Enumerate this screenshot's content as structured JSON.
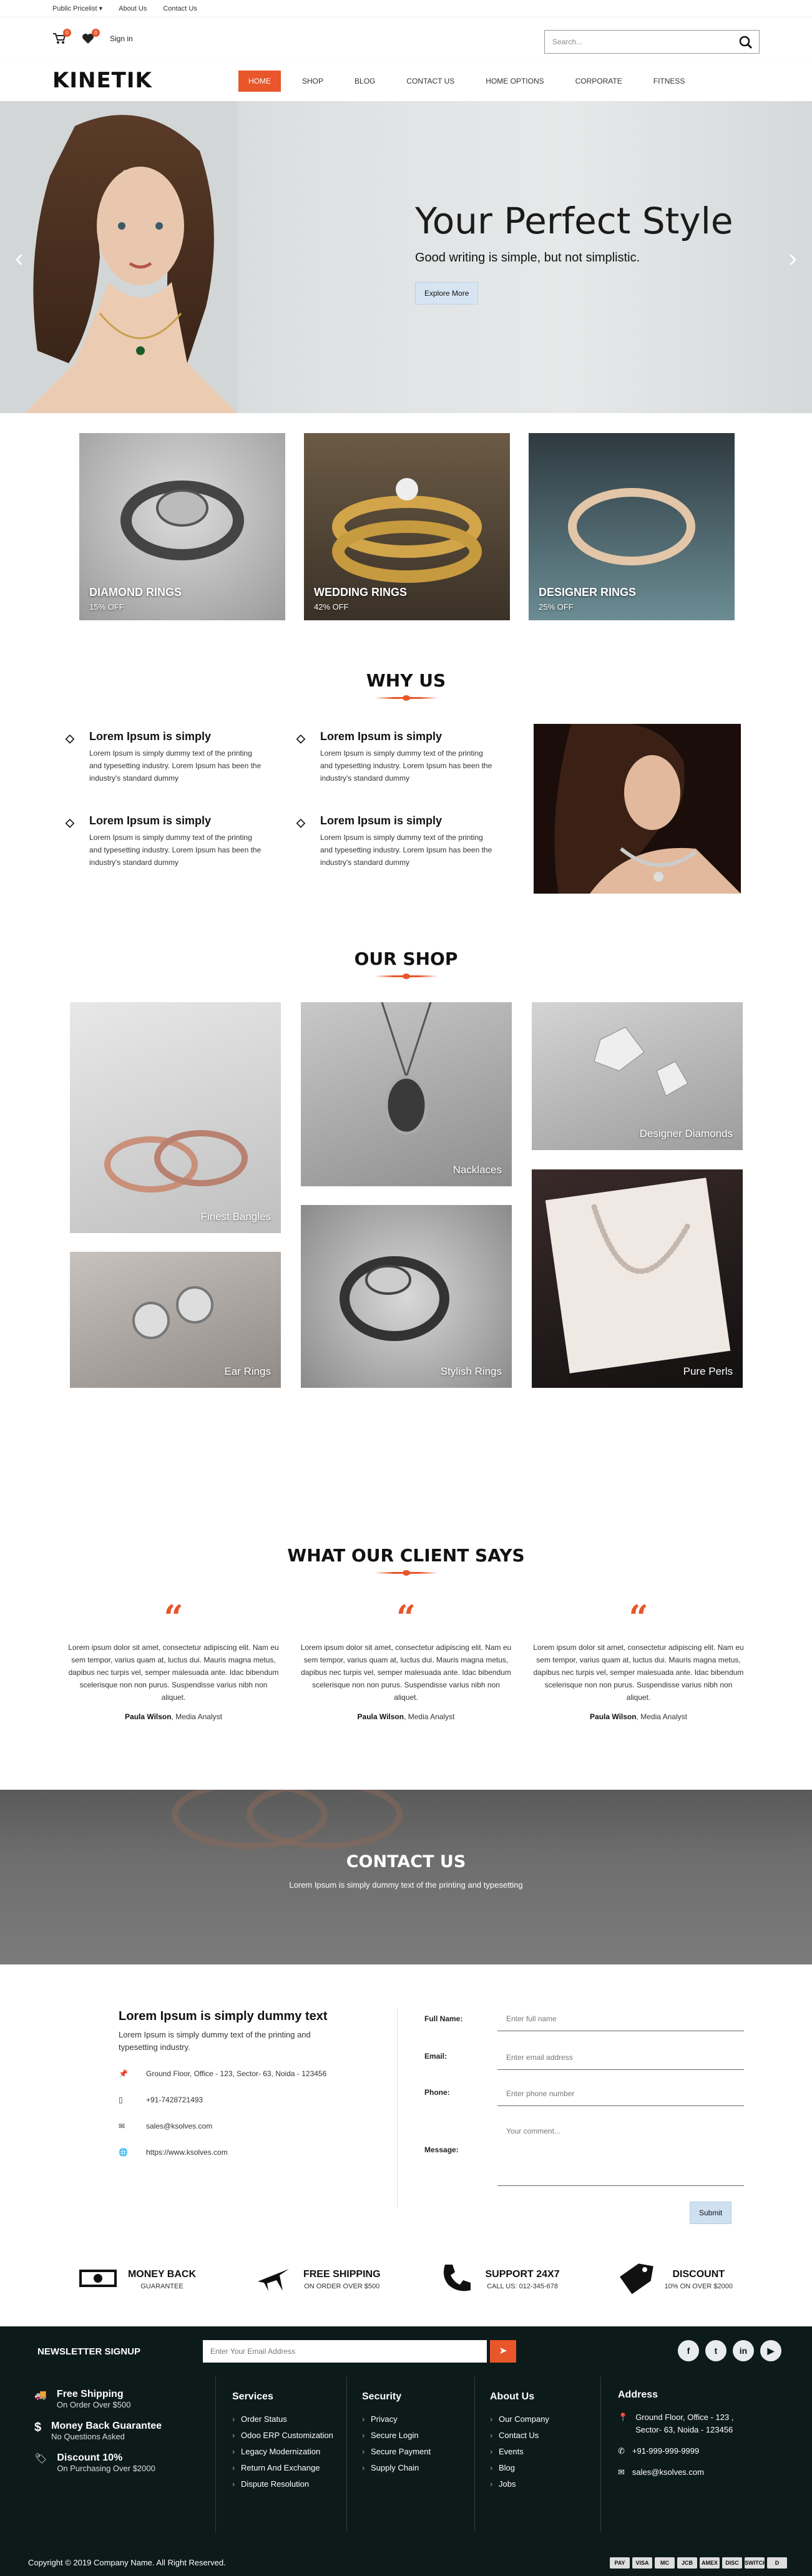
{
  "topbar": {
    "links": [
      "Public Pricelist ▾",
      "About Us",
      "Contact Us"
    ]
  },
  "header": {
    "cart_count": "0",
    "wish_count": "0",
    "signin": "Sign in",
    "search_placeholder": "Search..."
  },
  "logo": "KINETIK",
  "nav": [
    "HOME",
    "SHOP",
    "BLOG",
    "CONTACT US",
    "HOME OPTIONS",
    "CORPORATE",
    "FITNESS"
  ],
  "hero": {
    "title": "Your Perfect Style",
    "subtitle": "Good writing is simple, but not simplistic.",
    "button": "Explore More"
  },
  "categories": [
    {
      "name": "DIAMOND RINGS",
      "offer": "15% OFF"
    },
    {
      "name": "WEDDING RINGS",
      "offer": "42% OFF"
    },
    {
      "name": "DESIGNER RINGS",
      "offer": "25% OFF"
    }
  ],
  "why": {
    "title": "WHY US",
    "items": [
      {
        "heading": "Lorem Ipsum is simply",
        "text": "Lorem Ipsum is simply dummy text of the printing and typesetting industry. Lorem Ipsum has been the industry's standard dummy"
      },
      {
        "heading": "Lorem Ipsum is simply",
        "text": "Lorem Ipsum is simply dummy text of the printing and typesetting industry. Lorem Ipsum has been the industry's standard dummy"
      },
      {
        "heading": "Lorem Ipsum is simply",
        "text": "Lorem Ipsum is simply dummy text of the printing and typesetting industry. Lorem Ipsum has been the industry's standard dummy"
      },
      {
        "heading": "Lorem Ipsum is simply",
        "text": "Lorem Ipsum is simply dummy text of the printing and typesetting industry. Lorem Ipsum has been the industry's standard dummy"
      }
    ]
  },
  "shop": {
    "title": "OUR SHOP",
    "items": [
      "Finest Bangles",
      "Nacklaces",
      "Designer Diamonds",
      "Ear Rings",
      "Stylish Rings",
      "Pure Perls"
    ]
  },
  "testimonials": {
    "title": "WHAT OUR CLIENT SAYS",
    "items": [
      {
        "text": "Lorem ipsum dolor sit amet, consectetur adipiscing elit. Nam eu sem tempor, varius quam at, luctus dui. Mauris magna metus, dapibus nec turpis vel, semper malesuada ante. Idac bibendum scelerisque non non purus. Suspendisse varius nibh non aliquet.",
        "name": "Paula Wilson",
        "role": ", Media Analyst"
      },
      {
        "text": "Lorem ipsum dolor sit amet, consectetur adipiscing elit. Nam eu sem tempor, varius quam at, luctus dui. Mauris magna metus, dapibus nec turpis vel, semper malesuada ante. Idac bibendum scelerisque non non purus. Suspendisse varius nibh non aliquet.",
        "name": "Paula Wilson",
        "role": ", Media Analyst"
      },
      {
        "text": "Lorem ipsum dolor sit amet, consectetur adipiscing elit. Nam eu sem tempor, varius quam at, luctus dui. Mauris magna metus, dapibus nec turpis vel, semper malesuada ante. Idac bibendum scelerisque non non purus. Suspendisse varius nibh non aliquet.",
        "name": "Paula Wilson",
        "role": ", Media Analyst"
      }
    ]
  },
  "contact_band": {
    "title": "CONTACT US",
    "text": "Lorem Ipsum is simply dummy text of the printing and typesetting"
  },
  "contact": {
    "heading": "Lorem Ipsum is simply dummy text",
    "text": "Lorem Ipsum is simply dummy text of the printing and typesetting industry.",
    "address": "Ground Floor, Office - 123, Sector- 63, Noida - 123456",
    "phone": "+91-7428721493",
    "email": "sales@ksolves.com",
    "web": "https://www.ksolves.com",
    "form": {
      "name_label": "Full Name:",
      "name_ph": "Enter full name",
      "email_label": "Email:",
      "email_ph": "Enter email address",
      "phone_label": "Phone:",
      "phone_ph": "Enter phone number",
      "msg_label": "Message:",
      "msg_ph": "Your comment...",
      "submit": "Submit"
    }
  },
  "features": [
    {
      "title": "MONEY BACK",
      "sub": "GUARANTEE"
    },
    {
      "title": "FREE SHIPPING",
      "sub": "ON ORDER OVER $500"
    },
    {
      "title": "SUPPORT 24X7",
      "sub": "CALL US: 012-345-678"
    },
    {
      "title": "DISCOUNT",
      "sub": "10% ON OVER $2000"
    }
  ],
  "footer": {
    "newsletter": "NEWSLETTER SIGNUP",
    "nl_placeholder": "Enter Your Email Address",
    "social": [
      "f",
      "t",
      "in",
      "▶"
    ],
    "left": [
      {
        "title": "Free Shipping",
        "sub": "On Order Over $500"
      },
      {
        "title": "Money Back Guarantee",
        "sub": "No Questions Asked"
      },
      {
        "title": "Discount 10%",
        "sub": "On Purchasing Over $2000"
      }
    ],
    "services": {
      "title": "Services",
      "items": [
        "Order Status",
        "Odoo ERP Customization",
        "Legacy Modernization",
        "Return And Exchange",
        "Dispute Resolution"
      ]
    },
    "security": {
      "title": "Security",
      "items": [
        "Privacy",
        "Secure Login",
        "Secure Payment",
        "Supply Chain"
      ]
    },
    "about": {
      "title": "About Us",
      "items": [
        "Our Company",
        "Contact Us",
        "Events",
        "Blog",
        "Jobs"
      ]
    },
    "address": {
      "title": "Address",
      "addr": "Ground Floor, Office - 123 , Sector- 63, Noida - 123456",
      "phone": "+91-999-999-9999",
      "email": "sales@ksolves.com"
    },
    "copyright": "Copyright © 2019 Company Name. All Right Reserved.",
    "payments": [
      "PAY",
      "VISA",
      "MC",
      "JCB",
      "AMEX",
      "DISC",
      "SWITCH",
      "D"
    ]
  },
  "colors": {
    "accent": "#e8562a",
    "footer_bg": "#0d1a1a"
  }
}
